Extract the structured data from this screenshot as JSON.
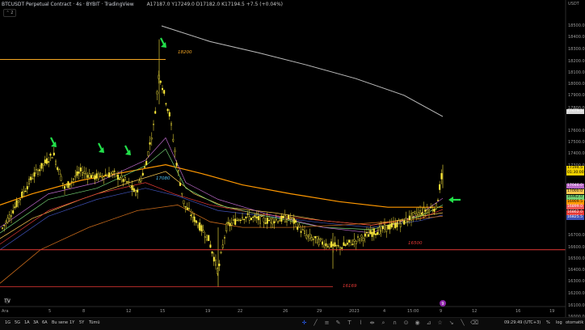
{
  "header": {
    "title": "BTCUSDT Perpetual Contract · 4s · BYBIT · TradingView",
    "ohlc": "A17187.0 Y17249.0 D17182.0 K17194.5 +7.5 (+0.04%)",
    "collapse_btn": "⌃ 2"
  },
  "yaxis": {
    "currency": "USDT",
    "ticks": [
      "18500.0",
      "18400.0",
      "18300.0",
      "18200.0",
      "18100.0",
      "18000.0",
      "17900.0",
      "17800.0",
      "17600.0",
      "17500.0",
      "17400.0",
      "17300.0",
      "17100.0",
      "17000.0",
      "16700.0",
      "16600.0",
      "16500.0",
      "16400.0",
      "16300.0",
      "16200.0",
      "16100.0",
      "16000.0"
    ],
    "tags": [
      {
        "text": "17679.5",
        "color": "#ffffff",
        "bg": "#d8d8d8"
      },
      {
        "text": "17194.5",
        "color": "#000000",
        "bg": "#f0d000"
      },
      {
        "text": "01:30:00",
        "color": "#000000",
        "bg": "#f0d000"
      },
      {
        "text": "17046.0",
        "color": "#ffffff",
        "bg": "#ba68c8"
      },
      {
        "text": "17000.0",
        "color": "#000000",
        "bg": "#f9c74f"
      },
      {
        "text": "16962.0",
        "color": "#000000",
        "bg": "#76d275"
      },
      {
        "text": "16909.5",
        "color": "#000000",
        "bg": "#ff9800"
      },
      {
        "text": "16899.0",
        "color": "#ffffff",
        "bg": "#ef5350"
      },
      {
        "text": "16862.0",
        "color": "#ffffff",
        "bg": "#e53935"
      },
      {
        "text": "16825.5",
        "color": "#ffffff",
        "bg": "#3f51b5"
      }
    ]
  },
  "xaxis": {
    "ticks": [
      "Ara",
      "5",
      "8",
      "12",
      "15",
      "19",
      "22",
      "26",
      "29",
      "2023",
      "4",
      "15:00",
      "9",
      "12",
      "16",
      "19"
    ]
  },
  "annotations": {
    "h_lines": [
      {
        "label": "18200",
        "color": "#f5a623"
      },
      {
        "label": "16500",
        "color": "#e53935"
      },
      {
        "label": "16169",
        "color": "#e53935"
      }
    ],
    "ma_label": "17080"
  },
  "chart_data": {
    "type": "candlestick",
    "title": "BTCUSDT Perpetual Contract · 4s · BYBIT",
    "ylim": [
      16000,
      18600
    ],
    "x_ticks": [
      "Ara",
      "5",
      "8",
      "12",
      "15",
      "19",
      "22",
      "26",
      "29",
      "2023",
      "4",
      "15:00",
      "9",
      "12",
      "16",
      "19"
    ],
    "levels": [
      18200,
      16500,
      16169
    ],
    "ma_label": 17080,
    "last_price": 17194.5
  },
  "bottom_bar": {
    "timeframes": [
      "1G",
      "5G",
      "1A",
      "3A",
      "6A",
      "Bu sene",
      "1Y",
      "5Y",
      "Tümü"
    ],
    "clock": "09:29:49 (UTC+3)",
    "right_items": [
      "%",
      "log",
      "otomatik"
    ]
  },
  "colors": {
    "bg": "#000000",
    "candle": "#ffeb3b",
    "arrow": "#22e04a",
    "orange_ma": "#ff9800",
    "grey_ma": "#bdbdbd"
  }
}
